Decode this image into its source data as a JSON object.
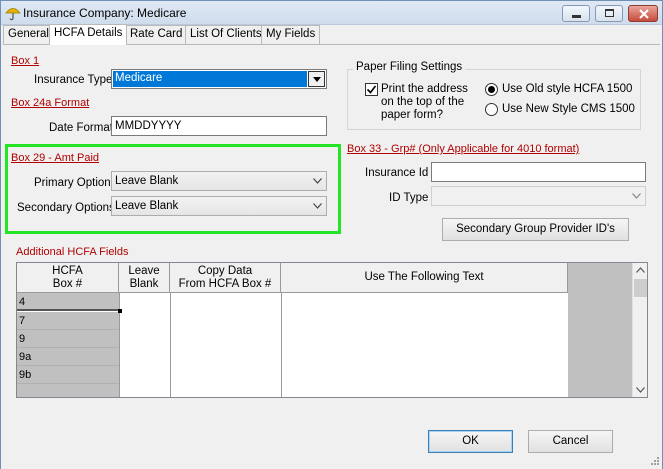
{
  "window": {
    "title": "Insurance Company: Medicare",
    "icons": {
      "app": "umbrella-icon",
      "minimize": "minimize-icon",
      "maximize": "maximize-icon",
      "close": "close-icon"
    }
  },
  "tabs": [
    {
      "label": "General",
      "active": false
    },
    {
      "label": "HCFA Details",
      "active": true
    },
    {
      "label": "Rate Card",
      "active": false
    },
    {
      "label": "List Of Clients",
      "active": false
    },
    {
      "label": "My Fields",
      "active": false
    }
  ],
  "box1": {
    "heading": "Box 1",
    "insurance_type_label": "Insurance Type",
    "insurance_type_value": "Medicare"
  },
  "box24a": {
    "heading": "Box 24a Format",
    "date_format_label": "Date Format",
    "date_format_value": "MMDDYYYY"
  },
  "box29": {
    "heading": "Box 29 - Amt Paid",
    "primary_label": "Primary Options",
    "primary_value": "Leave Blank",
    "secondary_label": "Secondary Options",
    "secondary_value": "Leave Blank"
  },
  "paper_filing": {
    "title": "Paper Filing Settings",
    "print_address_label_1": "Print the address",
    "print_address_label_2": "on the top of the",
    "print_address_label_3": "paper form?",
    "print_address_checked": true,
    "radio_old": "Use Old style HCFA 1500",
    "radio_new": "Use New Style CMS 1500",
    "selected": "old"
  },
  "box33": {
    "heading": "Box 33 - Grp# (Only Applicable for 4010 format)",
    "insurance_id_label": "Insurance Id",
    "insurance_id_value": "",
    "id_type_label": "ID Type",
    "id_type_value": "",
    "secondary_group_button": "Secondary Group Provider ID's"
  },
  "additional_fields": {
    "heading": "Additional HCFA Fields",
    "columns": {
      "box_1": "HCFA",
      "box_2": "Box #",
      "leave_1": "Leave",
      "leave_2": "Blank",
      "copy_1": "Copy Data",
      "copy_2": "From HCFA Box #",
      "text": "Use The Following Text"
    },
    "rows": [
      "4",
      "7",
      "9",
      "9a",
      "9b"
    ]
  },
  "footer": {
    "ok": "OK",
    "cancel": "Cancel"
  },
  "colors": {
    "heading_red": "#b00000",
    "highlight_green": "#23e523",
    "selection_blue": "#0078d7"
  }
}
